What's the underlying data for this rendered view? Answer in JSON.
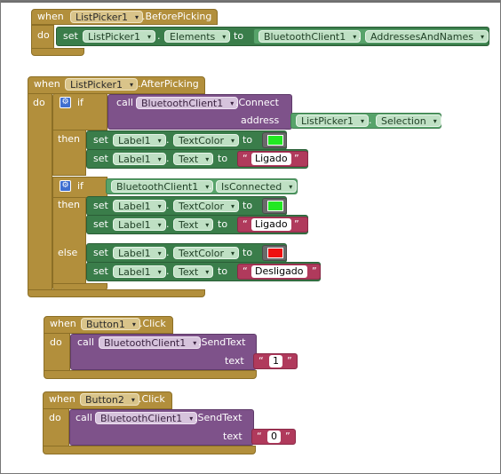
{
  "blocks": {
    "before_picking": {
      "when": "when",
      "component": "ListPicker1",
      "event": ".BeforePicking",
      "do": "do",
      "set": "set",
      "target": "ListPicker1",
      "dot": ".",
      "property": "Elements",
      "to": "to",
      "source_component": "BluetoothClient1",
      "source_property": "AddressesAndNames"
    },
    "after_picking": {
      "when": "when",
      "component": "ListPicker1",
      "event": ".AfterPicking",
      "do": "do",
      "if1": {
        "if": "if",
        "call": "call",
        "component": "BluetoothClient1",
        "method": ".Connect",
        "address": "address",
        "arg_component": "ListPicker1",
        "arg_property": "Selection",
        "then": "then",
        "stmt1": {
          "set": "set",
          "component": "Label1",
          "property": "TextColor",
          "to": "to",
          "color": "#22e822"
        },
        "stmt2": {
          "set": "set",
          "component": "Label1",
          "property": "Text",
          "to": "to",
          "value": "Ligado"
        }
      },
      "if2": {
        "if": "if",
        "component": "BluetoothClient1",
        "property": "IsConnected",
        "then": "then",
        "stmt1": {
          "set": "set",
          "component": "Label1",
          "property": "TextColor",
          "to": "to",
          "color": "#22e822"
        },
        "stmt2": {
          "set": "set",
          "component": "Label1",
          "property": "Text",
          "to": "to",
          "value": "Ligado"
        },
        "else": "else",
        "stmt3": {
          "set": "set",
          "component": "Label1",
          "property": "TextColor",
          "to": "to",
          "color": "#ee1111"
        },
        "stmt4": {
          "set": "set",
          "component": "Label1",
          "property": "Text",
          "to": "to",
          "value": "Desligado"
        }
      }
    },
    "button1_click": {
      "when": "when",
      "component": "Button1",
      "event": ".Click",
      "do": "do",
      "call": "call",
      "target": "BluetoothClient1",
      "method": ".SendText",
      "text": "text",
      "value": "1"
    },
    "button2_click": {
      "when": "when",
      "component": "Button2",
      "event": ".Click",
      "do": "do",
      "call": "call",
      "target": "BluetoothClient1",
      "method": ".SendText",
      "text": "text",
      "value": "0"
    }
  },
  "glyphs": {
    "dropdown_arrow": "▾",
    "gear": "⚙",
    "quote_open": "“",
    "quote_close": "”"
  }
}
